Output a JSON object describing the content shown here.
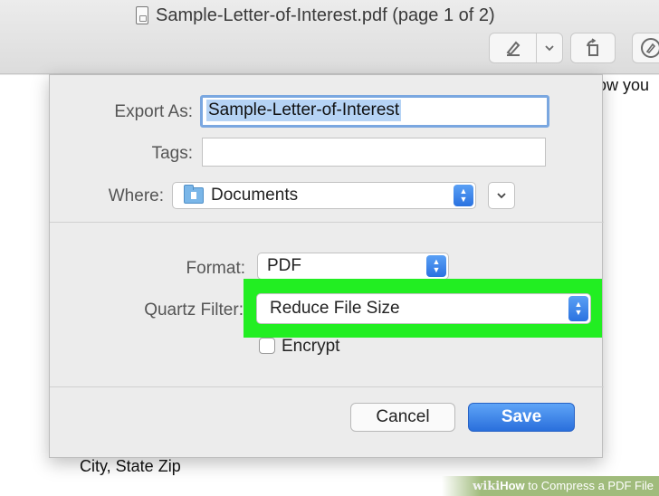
{
  "window": {
    "title": "Sample-Letter-of-Interest.pdf (page 1 of 2)"
  },
  "toolbar": {
    "items": [
      "markup-icon",
      "chevron-down-icon",
      "rotate-icon",
      "annotate-icon"
    ]
  },
  "document": {
    "text_top": "ow you",
    "text_bottom": "City, State Zip"
  },
  "dialog": {
    "export_as_label": "Export As:",
    "export_as_value": "Sample-Letter-of-Interest",
    "tags_label": "Tags:",
    "tags_value": "",
    "where_label": "Where:",
    "where_value": "Documents",
    "format_label": "Format:",
    "format_value": "PDF",
    "quartz_label": "Quartz Filter:",
    "quartz_value": "Reduce File Size",
    "encrypt_label": "Encrypt",
    "encrypt_checked": false,
    "cancel_label": "Cancel",
    "save_label": "Save"
  },
  "colors": {
    "highlight": "#22ee22",
    "accent": "#2a6fdc"
  },
  "watermark": {
    "brand": "wiki",
    "how": "How",
    "rest": " to Compress a PDF File"
  }
}
